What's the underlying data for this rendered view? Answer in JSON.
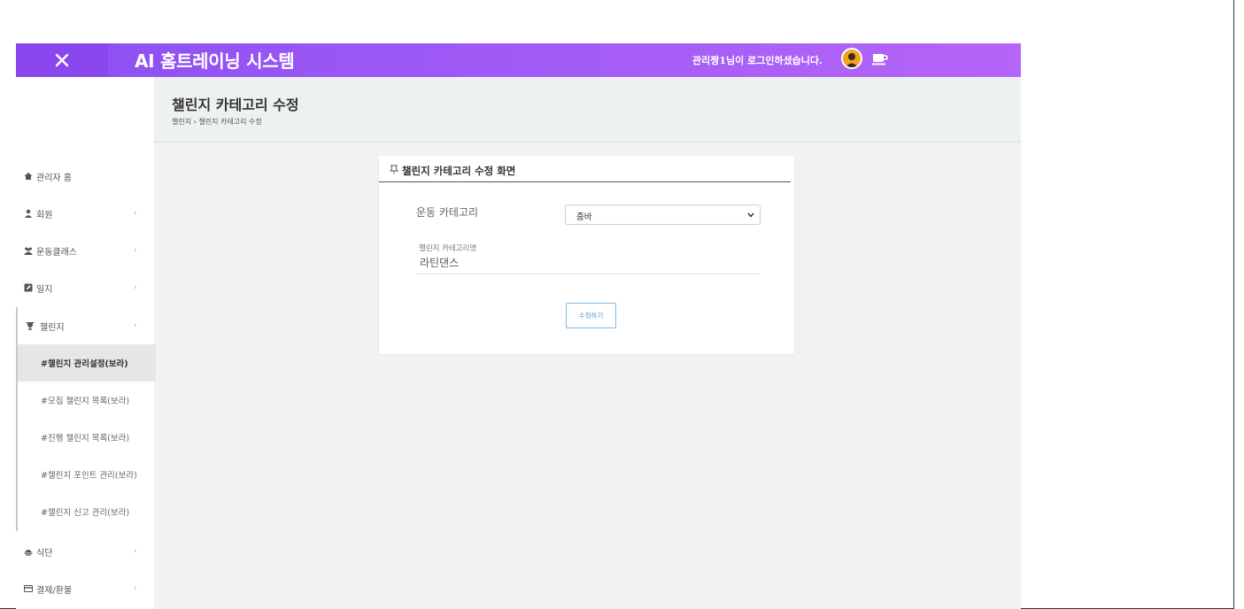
{
  "header": {
    "brand": "AI 홈트레이닝 시스템",
    "login_message": "관리짱1님이 로그인하셨습니다.",
    "icons": {
      "close": "close-icon",
      "avatar": "avatar-icon",
      "cup": "coffee-cup-icon"
    },
    "colors": {
      "gradient_start": "#8b4ff2",
      "gradient_end": "#b565f7"
    }
  },
  "page": {
    "title": "챌린지 카테고리 수정",
    "breadcrumb": [
      "챌린지",
      "챌린지 카테고리 수정"
    ],
    "breadcrumb_separator": "›"
  },
  "sidebar": {
    "items": [
      {
        "label": "관리자 홈",
        "icon": "home-icon",
        "arrow": ""
      },
      {
        "label": "회원",
        "icon": "user-icon",
        "arrow": "›"
      },
      {
        "label": "운동클래스",
        "icon": "group-icon",
        "arrow": "›"
      },
      {
        "label": "일지",
        "icon": "edit-icon",
        "arrow": "›"
      },
      {
        "label": "챌린지",
        "icon": "trophy-icon",
        "arrow": "›"
      },
      {
        "label": "식단",
        "icon": "food-icon",
        "arrow": "›"
      },
      {
        "label": "결제/환불",
        "icon": "credit-card-icon",
        "arrow": "›"
      }
    ],
    "challenge_sub": [
      {
        "label": "#챌린지 관리설정(보라)",
        "active": true
      },
      {
        "label": "#모집 챌린지 목록(보라)",
        "active": false
      },
      {
        "label": "#진행 챌린지 목록(보라)",
        "active": false
      },
      {
        "label": "#챌린지 포인트 관리(보라)",
        "active": false
      },
      {
        "label": "#챌린지 신고 관리(보라)",
        "active": false
      }
    ]
  },
  "form": {
    "card_title": "챌린지 카테고리 수정 화면",
    "category_label": "운동 카테고리",
    "category_selected": "줌바",
    "name_label": "챌린지 카테고리명",
    "name_value": "라틴댄스",
    "submit_label": "수정하기"
  }
}
